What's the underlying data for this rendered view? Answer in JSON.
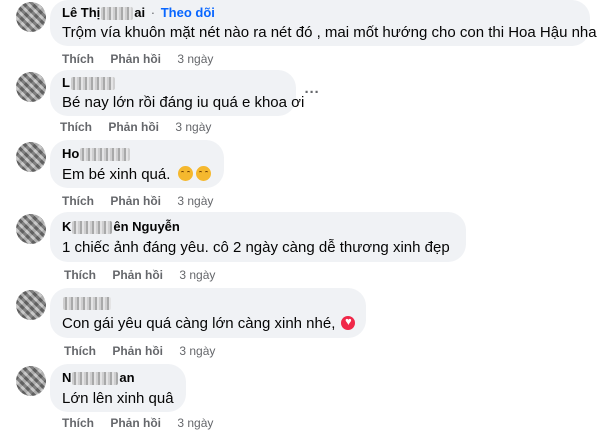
{
  "follow_label": "Theo dõi",
  "reply_label": "Phản hồi",
  "like_label": "Thích",
  "more_label": "···",
  "comments": [
    {
      "name_prefix": "Lê Thị",
      "name_suffix": "ai",
      "text": "Trộm vía khuôn mặt nét nào ra nét đó , mai mốt hướng cho con thi Hoa Hậu nha em",
      "time": "3 ngày",
      "reaction": ""
    },
    {
      "name_prefix": "L",
      "name_suffix": "",
      "text": "Bé nay lớn rồi đáng iu quá e khoa ơi",
      "time": "3 ngày",
      "reaction": ""
    },
    {
      "name_prefix": "Ho",
      "name_suffix": "",
      "text": "Em bé xinh quá.",
      "time": "3 ngày",
      "reaction": "blush-emoji"
    },
    {
      "name_prefix": "K",
      "name_suffix": "ên Nguyễn",
      "text": "1 chiếc ảnh đáng yêu. cô 2 ngày càng dễ thương xinh đẹp",
      "time": "3 ngày",
      "reaction": ""
    },
    {
      "name_prefix": "",
      "name_suffix": "",
      "text": "Con gái yêu quá càng lớn càng xinh nhé,",
      "time": "3 ngày",
      "reaction": "heart-emoji"
    },
    {
      "name_prefix": "N",
      "name_suffix": "an",
      "text": "Lớn lên xinh quâ",
      "time": "3 ngày",
      "reaction": ""
    }
  ]
}
